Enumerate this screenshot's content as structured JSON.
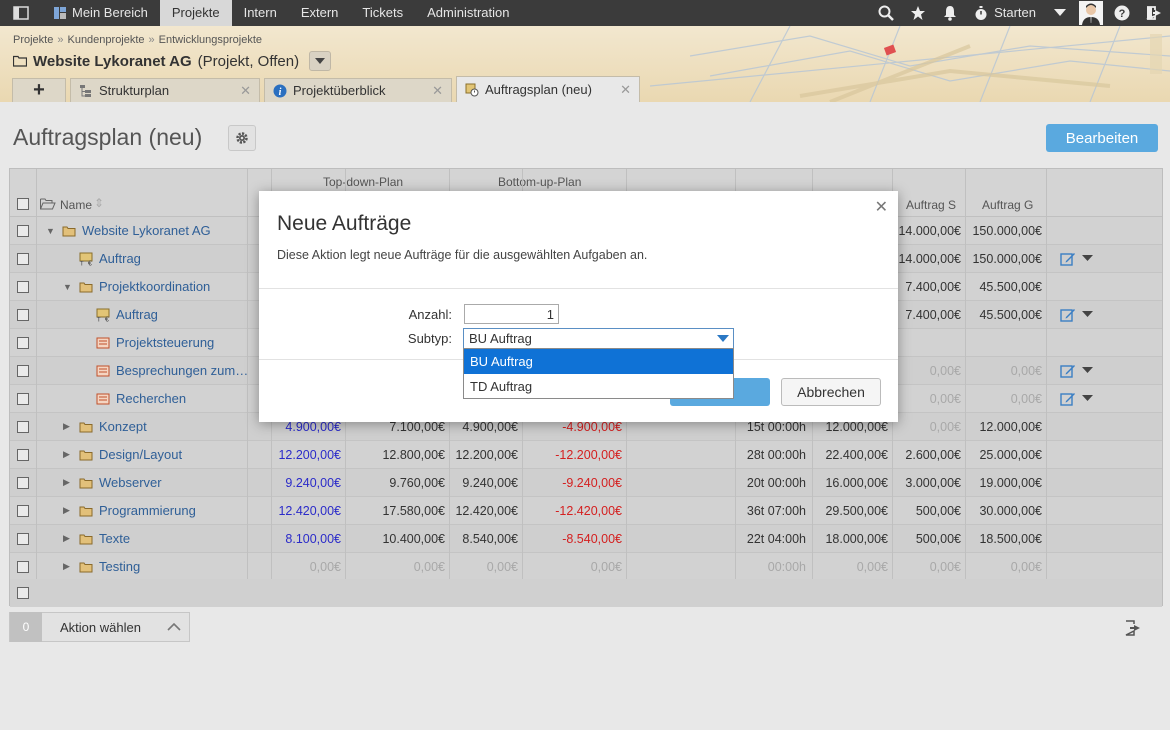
{
  "nav": {
    "items": [
      {
        "label": "Mein Bereich",
        "active": false
      },
      {
        "label": "Projekte",
        "active": true
      },
      {
        "label": "Intern",
        "active": false
      },
      {
        "label": "Extern",
        "active": false
      },
      {
        "label": "Tickets",
        "active": false
      },
      {
        "label": "Administration",
        "active": false
      }
    ],
    "starten_label": "Starten"
  },
  "breadcrumb": [
    "Projekte",
    "Kundenprojekte",
    "Entwicklungsprojekte"
  ],
  "project": {
    "name": "Website Lykoranet AG",
    "status": "(Projekt, Offen)"
  },
  "tabs": [
    {
      "label": "Strukturplan",
      "icon": "structure-icon"
    },
    {
      "label": "Projektüberblick",
      "icon": "info-icon"
    },
    {
      "label": "Auftragsplan (neu)",
      "icon": "order-plan-icon",
      "active": true
    }
  ],
  "page": {
    "title": "Auftragsplan (neu)",
    "edit_label": "Bearbeiten"
  },
  "grid": {
    "group_headers": [
      "Top-down-Plan",
      "Bottom-up-Plan"
    ],
    "col_name": "Name",
    "col_auftrag_s": "Auftrag S",
    "col_auftrag_g": "Auftrag G",
    "rows": [
      {
        "name": "Website Lykoranet AG",
        "level": 0,
        "expand": "open",
        "icon": "folder",
        "c1": "",
        "c2": "",
        "c3": "",
        "c4": "",
        "c5": "",
        "c6": "",
        "s": "14.000,00€",
        "g": "150.000,00€",
        "actions": false
      },
      {
        "name": "Auftrag",
        "level": 1,
        "expand": "",
        "icon": "order",
        "c1": "",
        "c2": "",
        "c3": "",
        "c4": "",
        "c5": "",
        "c6": "",
        "s": "14.000,00€",
        "g": "150.000,00€",
        "actions": true
      },
      {
        "name": "Projektkoordination",
        "level": 1,
        "expand": "open",
        "icon": "folder",
        "c1": "",
        "c2": "",
        "c3": "",
        "c4": "",
        "c5": "",
        "c6": "",
        "s": "7.400,00€",
        "g": "45.500,00€",
        "actions": false
      },
      {
        "name": "Auftrag",
        "level": 2,
        "expand": "",
        "icon": "order",
        "c1": "",
        "c2": "",
        "c3": "",
        "c4": "",
        "c5": "",
        "c6": "",
        "s": "7.400,00€",
        "g": "45.500,00€",
        "actions": true
      },
      {
        "name": "Projektsteuerung",
        "level": 2,
        "expand": "",
        "icon": "task",
        "c1": "",
        "c2": "",
        "c3": "",
        "c4": "",
        "c5": "",
        "c6": "",
        "s": "",
        "g": "",
        "actions": false
      },
      {
        "name": "Besprechungen zum…",
        "level": 2,
        "expand": "",
        "icon": "task",
        "c1": "",
        "c2": "",
        "c3": "",
        "c4": "",
        "c5": "",
        "c6": "",
        "s": "0,00€",
        "g": "0,00€",
        "actions": true,
        "grey": true
      },
      {
        "name": "Recherchen",
        "level": 2,
        "expand": "",
        "icon": "task",
        "c1": "",
        "c2": "",
        "c3": "",
        "c4": "",
        "c5": "",
        "c6": "",
        "s": "0,00€",
        "g": "0,00€",
        "actions": true,
        "grey": true
      },
      {
        "name": "Konzept",
        "level": 1,
        "expand": "closed",
        "icon": "folder",
        "c1": "4.900,00€",
        "c2": "7.100,00€",
        "c3": "4.900,00€",
        "c4": "-4.900,00€",
        "c5": "15t 00:00h",
        "c6": "12.000,00€",
        "s": "0,00€",
        "g": "12.000,00€",
        "actions": false,
        "sgrey": true
      },
      {
        "name": "Design/Layout",
        "level": 1,
        "expand": "closed",
        "icon": "folder",
        "c1": "12.200,00€",
        "c2": "12.800,00€",
        "c3": "12.200,00€",
        "c4": "-12.200,00€",
        "c5": "28t 00:00h",
        "c6": "22.400,00€",
        "s": "2.600,00€",
        "g": "25.000,00€",
        "actions": false
      },
      {
        "name": "Webserver",
        "level": 1,
        "expand": "closed",
        "icon": "folder",
        "c1": "9.240,00€",
        "c2": "9.760,00€",
        "c3": "9.240,00€",
        "c4": "-9.240,00€",
        "c5": "20t 00:00h",
        "c6": "16.000,00€",
        "s": "3.000,00€",
        "g": "19.000,00€",
        "actions": false
      },
      {
        "name": "Programmierung",
        "level": 1,
        "expand": "closed",
        "icon": "folder",
        "c1": "12.420,00€",
        "c2": "17.580,00€",
        "c3": "12.420,00€",
        "c4": "-12.420,00€",
        "c5": "36t 07:00h",
        "c6": "29.500,00€",
        "s": "500,00€",
        "g": "30.000,00€",
        "actions": false
      },
      {
        "name": "Texte",
        "level": 1,
        "expand": "closed",
        "icon": "folder",
        "c1": "8.100,00€",
        "c2": "10.400,00€",
        "c3": "8.540,00€",
        "c4": "-8.540,00€",
        "c5": "22t 04:00h",
        "c6": "18.000,00€",
        "s": "500,00€",
        "g": "18.500,00€",
        "actions": false
      },
      {
        "name": "Testing",
        "level": 1,
        "expand": "closed",
        "icon": "folder",
        "c1": "0,00€",
        "c2": "0,00€",
        "c3": "0,00€",
        "c4": "0,00€",
        "c5": "00:00h",
        "c6": "0,00€",
        "s": "0,00€",
        "g": "0,00€",
        "actions": false,
        "allgrey": true
      }
    ]
  },
  "actionbar": {
    "count": "0",
    "label": "Aktion wählen"
  },
  "modal": {
    "title": "Neue Aufträge",
    "description": "Diese Aktion legt neue Aufträge für die ausgewählten Aufgaben an.",
    "anzahl_label": "Anzahl:",
    "anzahl_value": "1",
    "subtyp_label": "Subtyp:",
    "subtyp_value": "BU Auftrag",
    "options": [
      "BU Auftrag",
      "TD Auftrag"
    ],
    "cancel_label": "Abbrechen"
  },
  "colors": {
    "accent": "#5aa9df",
    "nav_bg": "#3b3b3b",
    "selected_option": "#0f72d6",
    "negative": "#d42020",
    "plan_blue": "#2b2bc9"
  }
}
